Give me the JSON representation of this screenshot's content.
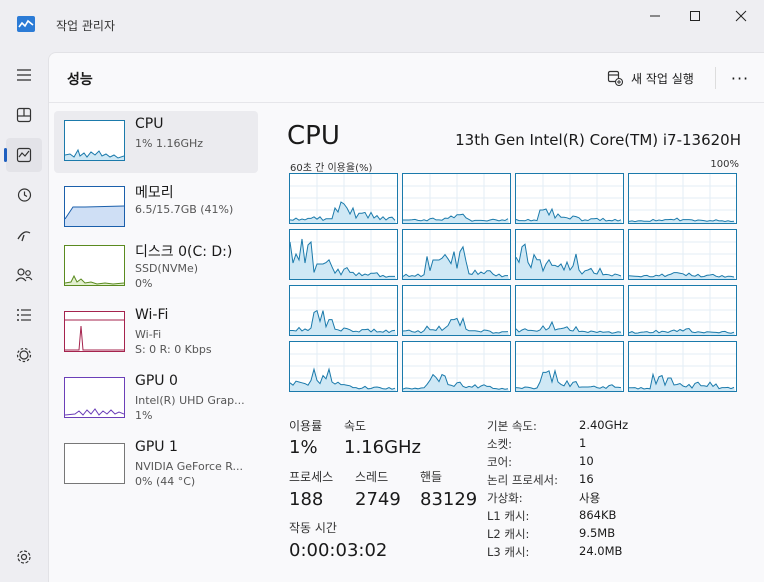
{
  "app": {
    "title": "작업 관리자"
  },
  "header": {
    "title": "성능",
    "new_task": "새 작업 실행",
    "more": "···"
  },
  "nav": [
    {
      "icon": "hamburger-icon"
    },
    {
      "icon": "processes-icon"
    },
    {
      "icon": "performance-icon"
    },
    {
      "icon": "app-history-icon"
    },
    {
      "icon": "startup-apps-icon"
    },
    {
      "icon": "users-icon"
    },
    {
      "icon": "details-icon"
    },
    {
      "icon": "services-icon"
    },
    {
      "icon": "settings-icon"
    }
  ],
  "resources": [
    {
      "name": "CPU",
      "sub1": "1% 1.16GHz",
      "sub2": "",
      "sub3": "",
      "color": "#1b7aab"
    },
    {
      "name": "메모리",
      "sub1": "6.5/15.7GB (41%)",
      "sub2": "",
      "sub3": "",
      "color": "#1b5fab"
    },
    {
      "name": "디스크 0(C: D:)",
      "sub1": "SSD(NVMe)",
      "sub2": "0%",
      "sub3": "",
      "color": "#5a8a1f"
    },
    {
      "name": "Wi-Fi",
      "sub1": "Wi-Fi",
      "sub2": "S: 0 R: 0 Kbps",
      "sub3": "",
      "color": "#a5234d"
    },
    {
      "name": "GPU 0",
      "sub1": "Intel(R) UHD Grap...",
      "sub2": "1%",
      "sub3": "",
      "color": "#6b3fb8"
    },
    {
      "name": "GPU 1",
      "sub1": "NVIDIA GeForce R...",
      "sub2": "0% (44 °C)",
      "sub3": "",
      "color": "#6b3fb8"
    }
  ],
  "detail": {
    "title": "CPU",
    "model": "13th Gen Intel(R) Core(TM) i7-13620H",
    "util_label": "60초 간 이용율(%)",
    "util_max": "100%",
    "utilization_label": "이용률",
    "utilization": "1%",
    "speed_label": "속도",
    "speed": "1.16GHz",
    "processes_label": "프로세스",
    "processes": "188",
    "threads_label": "스레드",
    "threads": "2749",
    "handles_label": "핸들",
    "handles": "83129",
    "uptime_label": "작동 시간",
    "uptime": "0:00:03:02",
    "specs": [
      {
        "label": "기본 속도:",
        "value": "2.40GHz"
      },
      {
        "label": "소켓:",
        "value": "1"
      },
      {
        "label": "코어:",
        "value": "10"
      },
      {
        "label": "논리 프로세서:",
        "value": "16"
      },
      {
        "label": "가상화:",
        "value": "사용"
      },
      {
        "label": "L1 캐시:",
        "value": "864KB"
      },
      {
        "label": "L2 캐시:",
        "value": "9.5MB"
      },
      {
        "label": "L3 캐시:",
        "value": "24.0MB"
      }
    ]
  },
  "colors": {
    "accent": "#1f5fbf",
    "cpu_line": "#1b7aab",
    "cpu_fill": "#cfe8f5"
  }
}
